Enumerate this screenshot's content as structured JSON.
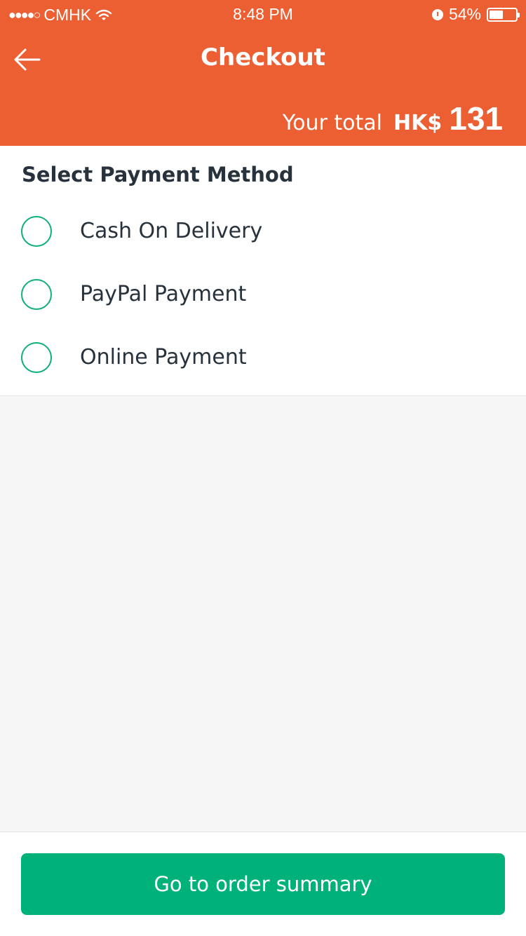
{
  "status_bar": {
    "signal": "●●●●○",
    "carrier": "CMHK",
    "time": "8:48 PM",
    "battery_percent": "54%",
    "battery_level": 0.54
  },
  "header": {
    "title": "Checkout",
    "back_icon": "arrow-left-icon",
    "total_label": "Your total",
    "currency": "HK$",
    "total_amount": "131"
  },
  "payment": {
    "section_title": "Select Payment Method",
    "options": [
      {
        "label": "Cash On Delivery",
        "selected": false
      },
      {
        "label": "PayPal Payment",
        "selected": false
      },
      {
        "label": "Online Payment",
        "selected": false
      }
    ]
  },
  "footer": {
    "button_label": "Go to order summary"
  },
  "colors": {
    "header_bg": "#eb5f32",
    "accent_green": "#00b27a",
    "radio_border": "#0faf78",
    "text_dark": "#27323c",
    "page_bg": "#f5f6f5"
  }
}
